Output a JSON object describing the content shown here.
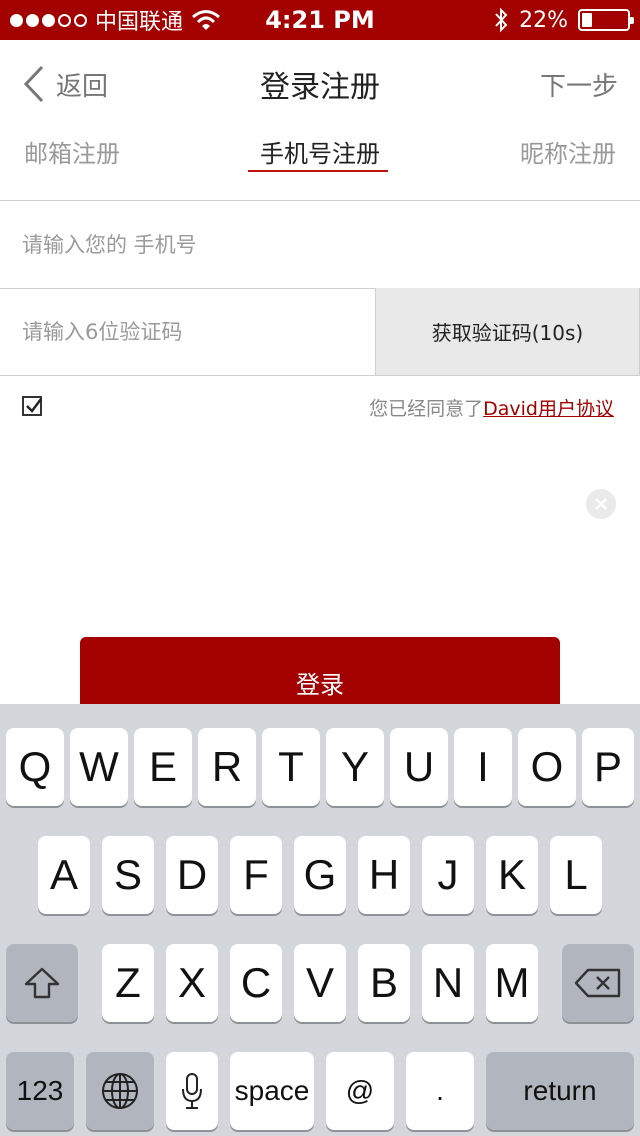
{
  "status_bar": {
    "carrier": "中国联通",
    "time": "4:21 PM",
    "battery_text": "22%",
    "battery_level": 0.22
  },
  "nav": {
    "back_label": "返回",
    "title": "登录注册",
    "next_label": "下一步"
  },
  "tabs": [
    {
      "label": "邮箱注册",
      "active": false
    },
    {
      "label": "手机号注册",
      "active": true
    },
    {
      "label": "昵称注册",
      "active": false
    }
  ],
  "form": {
    "phone_placeholder": "请输入您的 手机号",
    "phone_value": "",
    "code_placeholder": "请输入6位验证码",
    "code_value": "",
    "get_code_label": "获取验证码(10s)",
    "agree_checked": true,
    "agree_text": "您已经同意了",
    "agree_link": "David用户协议",
    "login_label": "登录"
  },
  "keyboard": {
    "row1": [
      "Q",
      "W",
      "E",
      "R",
      "T",
      "Y",
      "U",
      "I",
      "O",
      "P"
    ],
    "row2": [
      "A",
      "S",
      "D",
      "F",
      "G",
      "H",
      "J",
      "K",
      "L"
    ],
    "row3": [
      "Z",
      "X",
      "C",
      "V",
      "B",
      "N",
      "M"
    ],
    "numbers_label": "123",
    "space_label": "space",
    "at_label": "@",
    "period_label": ".",
    "return_label": "return"
  },
  "colors": {
    "brand": "#a30000",
    "tab_underline": "#c31010",
    "keyboard_bg": "#d3d6db"
  }
}
